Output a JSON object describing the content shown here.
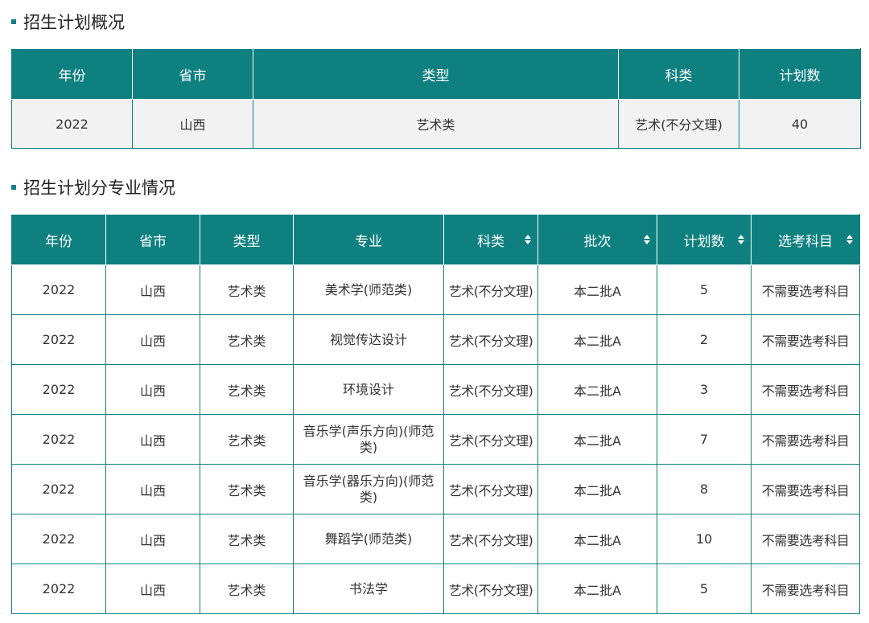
{
  "section1": {
    "title": "招生计划概况",
    "headers": [
      "年份",
      "省市",
      "类型",
      "科类",
      "计划数"
    ],
    "row": [
      "2022",
      "山西",
      "艺术类",
      "艺术(不分文理)",
      "40"
    ]
  },
  "section2": {
    "title": "招生计划分专业情况",
    "headers": [
      "年份",
      "省市",
      "类型",
      "专业",
      "科类",
      "批次",
      "计划数",
      "选考科目"
    ],
    "rows": [
      [
        "2022",
        "山西",
        "艺术类",
        "美术学(师范类)",
        "艺术(不分文理)",
        "本二批A",
        "5",
        "不需要选考科目"
      ],
      [
        "2022",
        "山西",
        "艺术类",
        "视觉传达设计",
        "艺术(不分文理)",
        "本二批A",
        "2",
        "不需要选考科目"
      ],
      [
        "2022",
        "山西",
        "艺术类",
        "环境设计",
        "艺术(不分文理)",
        "本二批A",
        "3",
        "不需要选考科目"
      ],
      [
        "2022",
        "山西",
        "艺术类",
        "音乐学(声乐方向)(师范类)",
        "艺术(不分文理)",
        "本二批A",
        "7",
        "不需要选考科目"
      ],
      [
        "2022",
        "山西",
        "艺术类",
        "音乐学(器乐方向)(师范类)",
        "艺术(不分文理)",
        "本二批A",
        "8",
        "不需要选考科目"
      ],
      [
        "2022",
        "山西",
        "艺术类",
        "舞蹈学(师范类)",
        "艺术(不分文理)",
        "本二批A",
        "10",
        "不需要选考科目"
      ],
      [
        "2022",
        "山西",
        "艺术类",
        "书法学",
        "艺术(不分文理)",
        "本二批A",
        "5",
        "不需要选考科目"
      ]
    ]
  },
  "theme": {
    "accent": "#0f8080",
    "summary_row_bg": "#f2f2f2"
  },
  "icons": {
    "sort": "sort-updown-icon",
    "bullet": "square-bullet-icon"
  }
}
